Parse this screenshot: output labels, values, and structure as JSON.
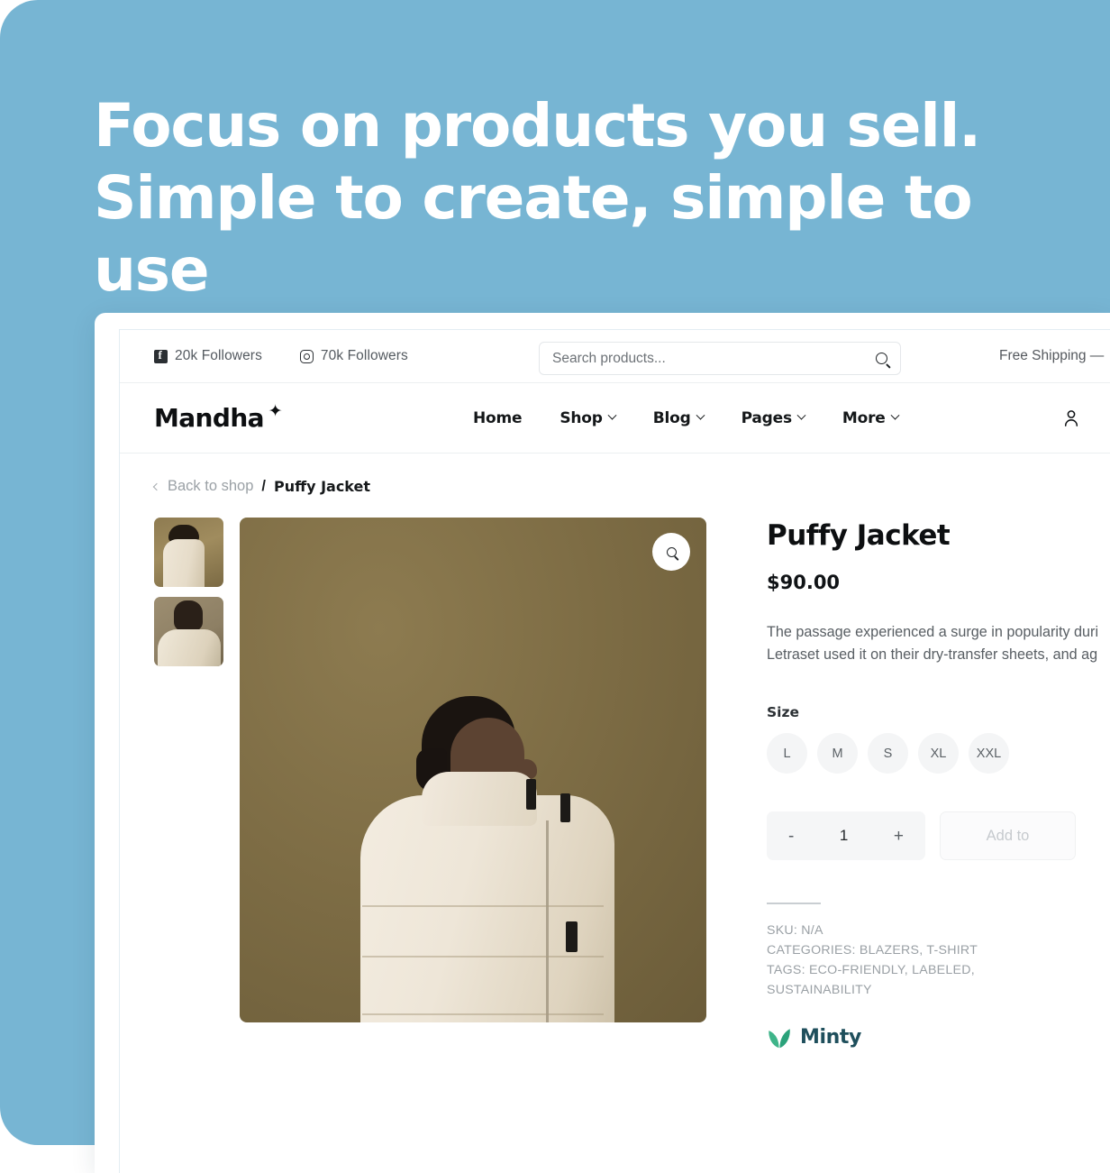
{
  "hero": {
    "line1": "Focus on products you sell.",
    "line2": "Simple to create, simple to use",
    "background_color": "#77b5d3",
    "text_color": "#ffffff"
  },
  "topbar": {
    "facebook": {
      "icon": "facebook-icon",
      "label": "20k Followers"
    },
    "instagram": {
      "icon": "instagram-icon",
      "label": "70k Followers"
    },
    "search": {
      "icon": "search-icon",
      "placeholder": "Search products...",
      "value": ""
    },
    "shipping_notice": "Free Shipping —"
  },
  "navbar": {
    "logo": "Mandha",
    "logo_mark": "sparkle-icon",
    "links": [
      {
        "label": "Home",
        "has_dropdown": false
      },
      {
        "label": "Shop",
        "has_dropdown": true
      },
      {
        "label": "Blog",
        "has_dropdown": true
      },
      {
        "label": "Pages",
        "has_dropdown": true
      },
      {
        "label": "More",
        "has_dropdown": true
      }
    ],
    "account_icon": "user-icon"
  },
  "breadcrumb": {
    "back_label": "Back to shop",
    "separator": "/",
    "current": "Puffy Jacket"
  },
  "gallery": {
    "thumbnails": [
      {
        "alt": "Model side profile wearing cream puffy jacket"
      },
      {
        "alt": "Model front portrait wearing cream puffy jacket"
      }
    ],
    "zoom_icon": "magnifier-icon",
    "main_image_alt": "Man in cream puffy jacket, side profile on brown backdrop"
  },
  "product": {
    "title": "Puffy Jacket",
    "price": "$90.00",
    "description_line1": "The passage experienced a surge in popularity duri",
    "description_line2": "Letraset used it on their dry-transfer sheets, and ag",
    "size_label": "Size",
    "sizes": [
      "L",
      "M",
      "S",
      "XL",
      "XXL"
    ],
    "quantity": {
      "decrement": "-",
      "value": "1",
      "increment": "+"
    },
    "add_to_cart_label": "Add to",
    "meta": {
      "sku": "SKU: N/A",
      "categories": "CATEGORIES: BLAZERS, T-SHIRT",
      "tags": "TAGS: ECO-FRIENDLY, LABELED, SUSTAINABILITY"
    },
    "badge": {
      "name": "Minty",
      "icon": "leaf-icon",
      "leaf_color": "#3eb489",
      "text_color": "#1f4f5c"
    }
  }
}
